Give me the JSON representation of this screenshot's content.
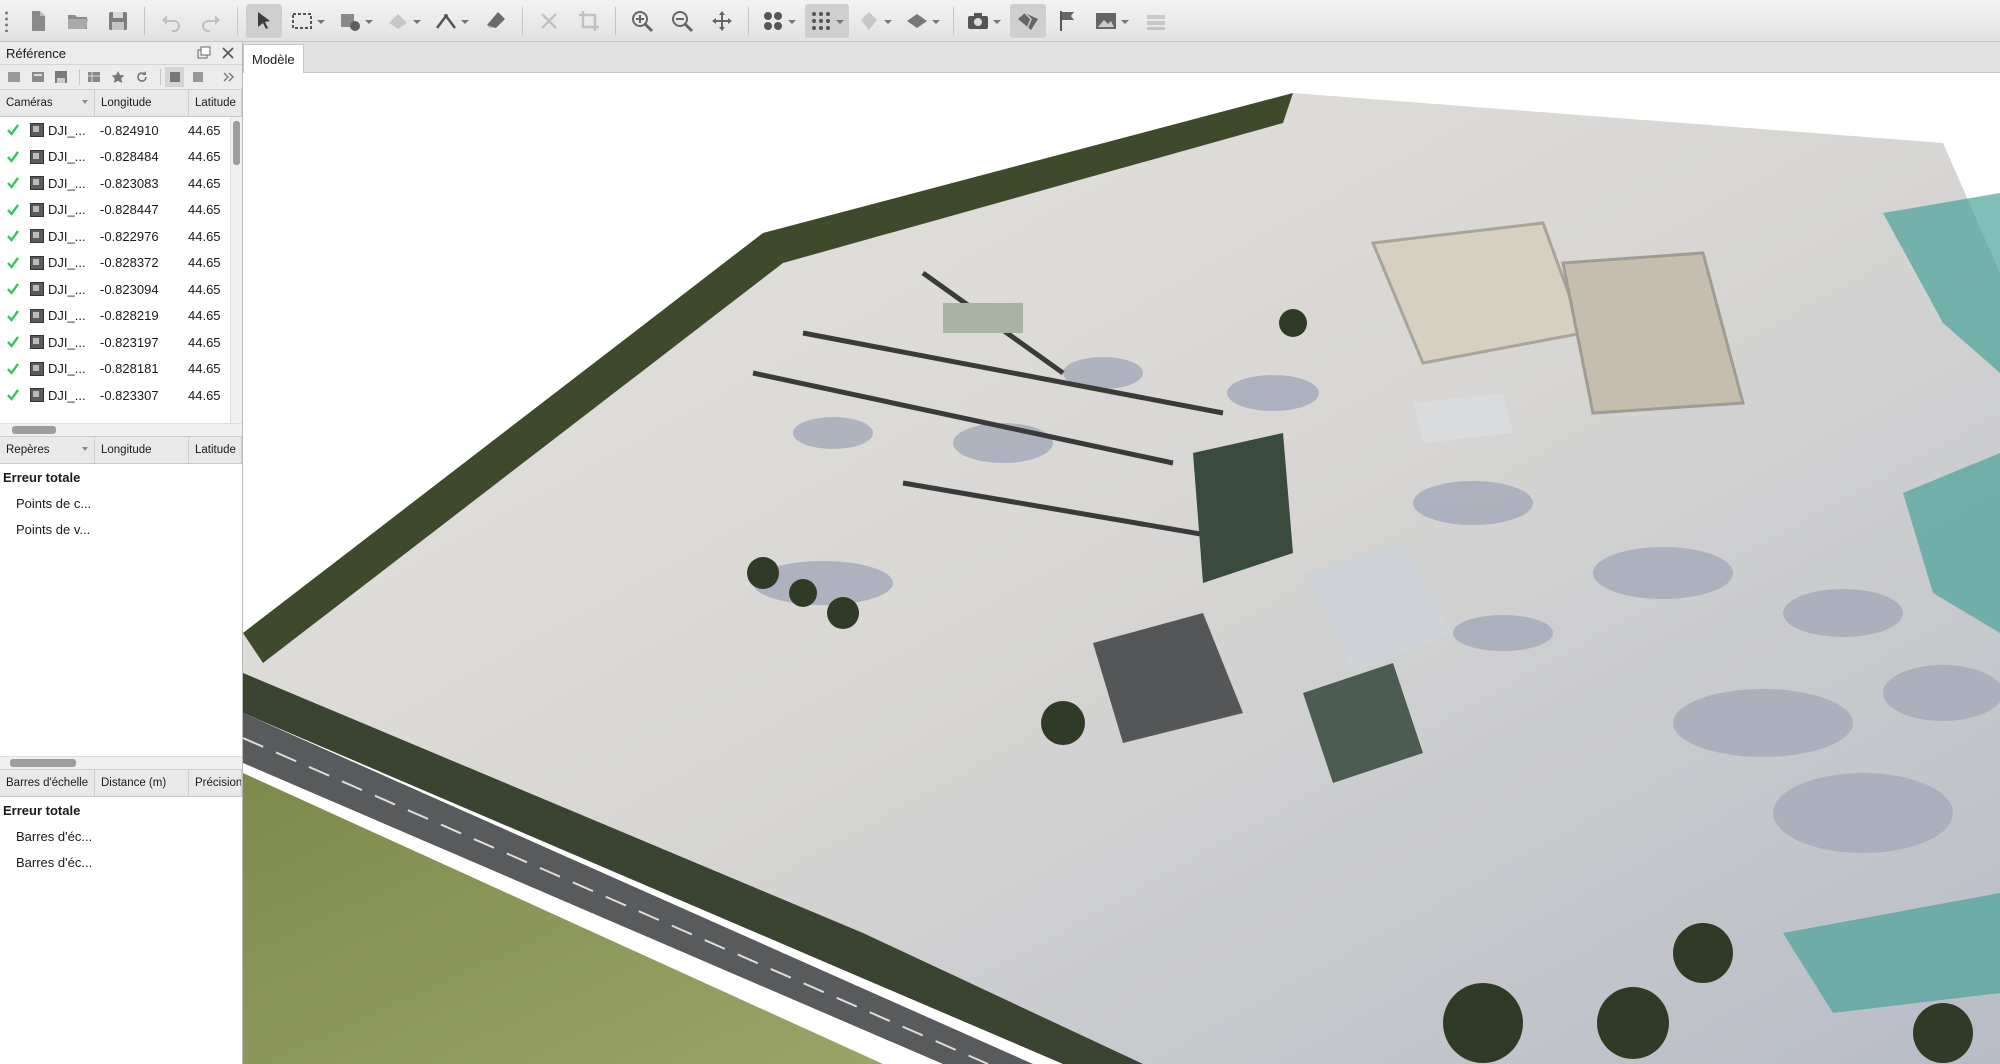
{
  "toolbar": {
    "tools": [
      "new-icon",
      "open-icon",
      "save-icon",
      "undo-icon",
      "redo-icon",
      "select-icon",
      "rect-select-icon",
      "brush-select-icon",
      "shape-icon",
      "ruler-icon",
      "eraser-icon",
      "delete-icon",
      "crop-icon",
      "zoom-in-icon",
      "zoom-out-icon",
      "move-icon",
      "points-icon",
      "grid-icon",
      "tiepoint-icon",
      "surface-icon",
      "camera-icon",
      "model-icon",
      "flag-icon",
      "image-icon",
      "stack-icon"
    ]
  },
  "panel": {
    "title": "Référence",
    "cameras_table": {
      "headers": [
        "Caméras",
        "Longitude",
        "Latitude"
      ],
      "rows": [
        {
          "name": "DJI_...",
          "lon": "-0.824910",
          "lat": "44.65"
        },
        {
          "name": "DJI_...",
          "lon": "-0.828484",
          "lat": "44.65"
        },
        {
          "name": "DJI_...",
          "lon": "-0.823083",
          "lat": "44.65"
        },
        {
          "name": "DJI_...",
          "lon": "-0.828447",
          "lat": "44.65"
        },
        {
          "name": "DJI_...",
          "lon": "-0.822976",
          "lat": "44.65"
        },
        {
          "name": "DJI_...",
          "lon": "-0.828372",
          "lat": "44.65"
        },
        {
          "name": "DJI_...",
          "lon": "-0.823094",
          "lat": "44.65"
        },
        {
          "name": "DJI_...",
          "lon": "-0.828219",
          "lat": "44.65"
        },
        {
          "name": "DJI_...",
          "lon": "-0.823197",
          "lat": "44.65"
        },
        {
          "name": "DJI_...",
          "lon": "-0.828181",
          "lat": "44.65"
        },
        {
          "name": "DJI_...",
          "lon": "-0.823307",
          "lat": "44.65"
        }
      ]
    },
    "markers_table": {
      "headers": [
        "Repères",
        "Longitude",
        "Latitude"
      ],
      "total": "Erreur totale",
      "items": [
        "Points de c...",
        "Points de v..."
      ]
    },
    "scalebars_table": {
      "headers": [
        "Barres d'échelle",
        "Distance (m)",
        "Précision"
      ],
      "total": "Erreur totale",
      "items": [
        "Barres d'éc...",
        "Barres d'éc..."
      ]
    }
  },
  "model": {
    "tab_label": "Modèle"
  },
  "colors": {
    "check": "#2ec95a",
    "panel_bg": "#ffffff",
    "toolbar_bg": "#e8e8e8"
  }
}
